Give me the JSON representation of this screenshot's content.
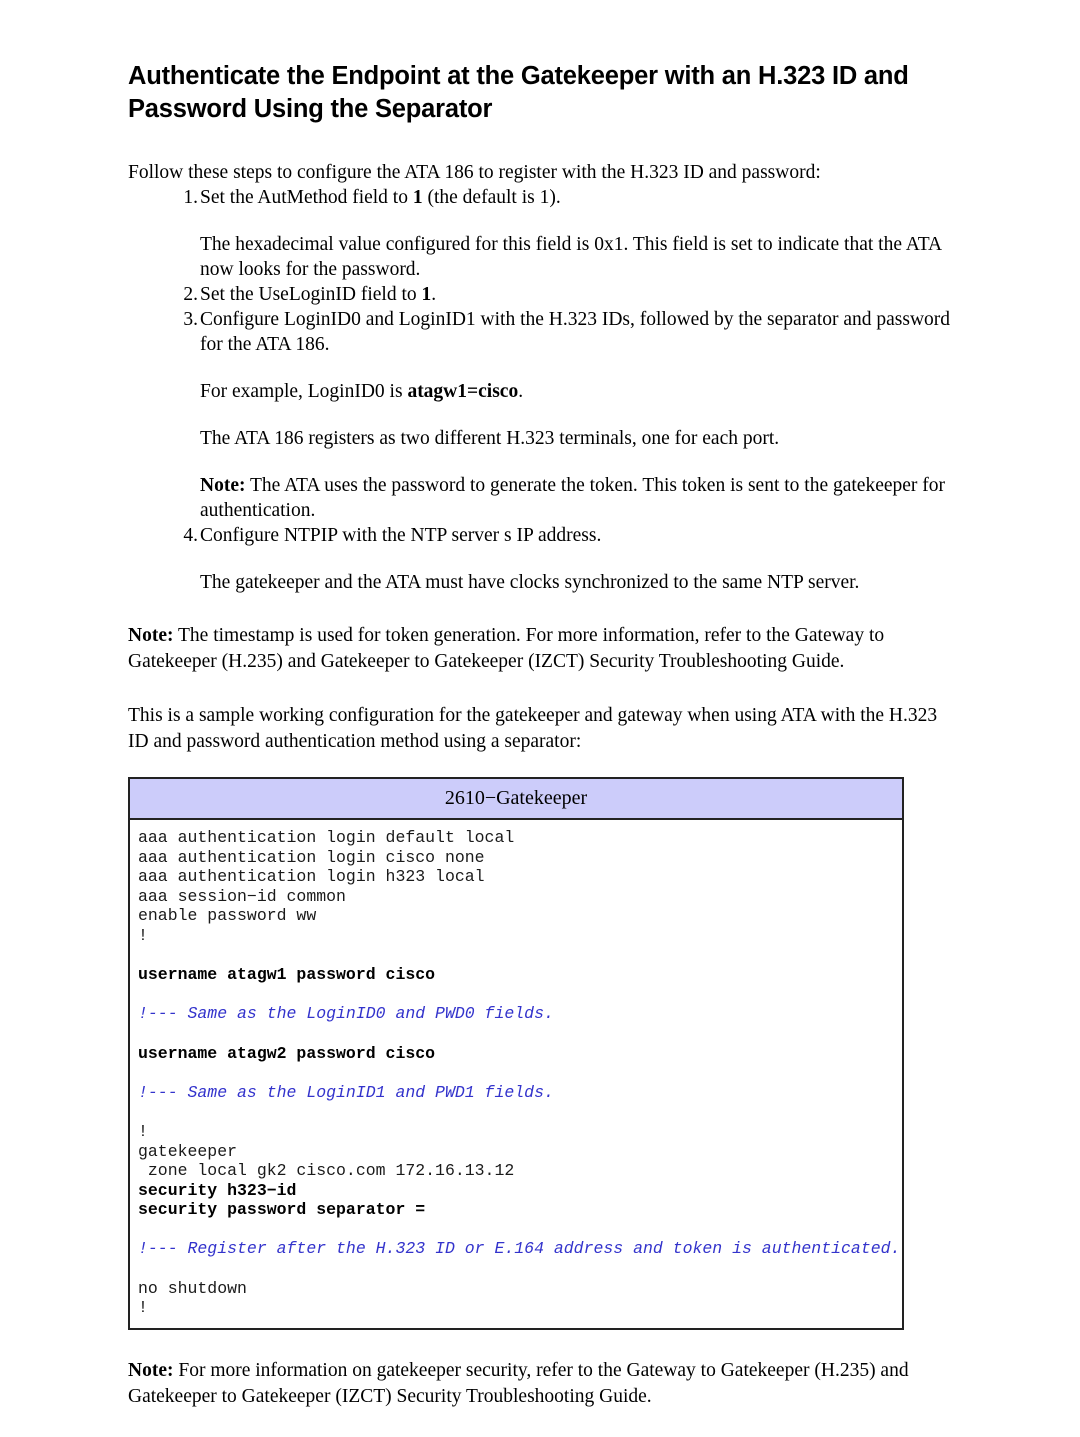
{
  "document": {
    "title": "Authenticate the Endpoint at the Gatekeeper with an H.323 ID and Password Using the Separator",
    "intro": "Follow these steps to configure the ATA 186 to register with the H.323 ID and password:",
    "steps": [
      {
        "num": "1.",
        "text_before": "Set the AutMethod field to ",
        "bold": "1",
        "text_after": " (the default is 1)."
      },
      {
        "num": "2.",
        "text_before": "Set the UseLoginID field to ",
        "bold": "1",
        "text_after": "."
      },
      {
        "num": "3.",
        "text_before": "Configure LoginID0 and LoginID1 with the H.323 IDs, followed by the separator and password for the ATA 186.",
        "bold": "",
        "text_after": ""
      },
      {
        "num": "4.",
        "text_before": "Configure NTPIP with the NTP server s IP address.",
        "bold": "",
        "text_after": ""
      }
    ],
    "sub_paragraphs": {
      "hex_value": "The hexadecimal value configured for this field is 0x1. This field is set to indicate that the ATA now looks for the password.",
      "for_example_before": "For example, LoginID0 is ",
      "for_example_bold": "atagw1=cisco",
      "for_example_after": ".",
      "registers": "The ATA 186 registers as two different H.323 terminals, one for each port.",
      "note1_label": "Note:",
      "note1_text": " The ATA uses the password to generate the token. This token is sent to the gatekeeper for authentication.",
      "clocks": "The gatekeeper and the ATA must have clocks synchronized to the same NTP server."
    },
    "note_timestamp": {
      "label": "Note:",
      "text": " The timestamp is used for token generation. For more information, refer to the Gateway to Gatekeeper (H.235) and Gatekeeper to Gatekeeper (IZCT) Security Troubleshooting Guide."
    },
    "sample_intro": "This is a sample working configuration for the gatekeeper and gateway when using ATA with the H.323 ID and password authentication method using a separator:",
    "note_bottom": {
      "label": "Note:",
      "text": " For more information on gatekeeper security, refer to the Gateway to Gatekeeper (H.235) and Gatekeeper to Gatekeeper (IZCT) Security Troubleshooting Guide."
    }
  },
  "code_box": {
    "header": "2610−Gatekeeper",
    "header_bg": "#ccccfa",
    "comment_color": "#3333cc",
    "lines": [
      {
        "text": "aaa authentication login default local",
        "style": "plain"
      },
      {
        "text": "aaa authentication login cisco none",
        "style": "plain"
      },
      {
        "text": "aaa authentication login h323 local",
        "style": "plain"
      },
      {
        "text": "aaa session−id common",
        "style": "plain"
      },
      {
        "text": "enable password ww",
        "style": "plain"
      },
      {
        "text": "!",
        "style": "plain"
      },
      {
        "text": "",
        "style": "blank"
      },
      {
        "text": "username atagw1 password cisco",
        "style": "bold"
      },
      {
        "text": "",
        "style": "blank"
      },
      {
        "text": "!--- Same as the LoginID0 and PWD0 fields.",
        "style": "comment"
      },
      {
        "text": "",
        "style": "blank"
      },
      {
        "text": "username atagw2 password cisco",
        "style": "bold"
      },
      {
        "text": "",
        "style": "blank"
      },
      {
        "text": "!--- Same as the LoginID1 and PWD1 fields.",
        "style": "comment"
      },
      {
        "text": "",
        "style": "blank"
      },
      {
        "text": "!",
        "style": "plain"
      },
      {
        "text": "gatekeeper",
        "style": "plain"
      },
      {
        "text": " zone local gk2 cisco.com 172.16.13.12",
        "style": "plain"
      },
      {
        "text": "security h323−id",
        "style": "bold"
      },
      {
        "text": "security password separator =",
        "style": "bold"
      },
      {
        "text": "",
        "style": "blank"
      },
      {
        "text": "!--- Register after the H.323 ID or E.164 address and token is authenticated.",
        "style": "comment"
      },
      {
        "text": "",
        "style": "blank"
      },
      {
        "text": "no shutdown",
        "style": "plain"
      },
      {
        "text": "!",
        "style": "plain"
      }
    ]
  }
}
